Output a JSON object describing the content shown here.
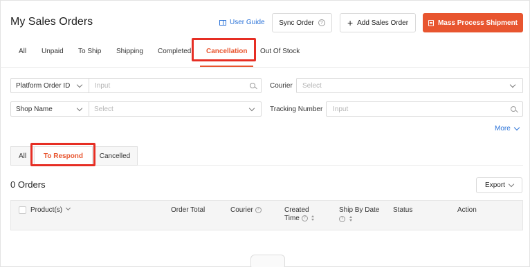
{
  "header": {
    "title": "My Sales Orders",
    "user_guide": "User Guide",
    "sync_order": "Sync Order",
    "add_sales_order": "Add Sales Order",
    "mass_process_shipment": "Mass Process Shipment"
  },
  "tabs": [
    {
      "label": "All"
    },
    {
      "label": "Unpaid"
    },
    {
      "label": "To Ship"
    },
    {
      "label": "Shipping"
    },
    {
      "label": "Completed"
    },
    {
      "label": "Cancellation",
      "active": true
    },
    {
      "label": "Out Of Stock"
    }
  ],
  "filters": {
    "order_id": {
      "label": "Platform Order ID",
      "placeholder": "Input"
    },
    "courier": {
      "label": "Courier",
      "placeholder": "Select"
    },
    "shop": {
      "label": "Shop Name",
      "placeholder": "Select"
    },
    "tracking": {
      "label": "Tracking Number",
      "placeholder": "Input"
    },
    "more": "More"
  },
  "subtabs": [
    {
      "label": "All"
    },
    {
      "label": "To Respond",
      "active": true
    },
    {
      "label": "Cancelled"
    }
  ],
  "orders": {
    "count_label": "0 Orders",
    "export": "Export"
  },
  "table": {
    "columns": {
      "products": "Product(s)",
      "order_total": "Order Total",
      "courier": "Courier",
      "created_time_1": "Created",
      "created_time_2": "Time",
      "ship_by_date": "Ship By Date",
      "status": "Status",
      "action": "Action"
    }
  },
  "colors": {
    "accent": "#e8552f",
    "link": "#2b73d8",
    "highlight": "#e62e24"
  }
}
